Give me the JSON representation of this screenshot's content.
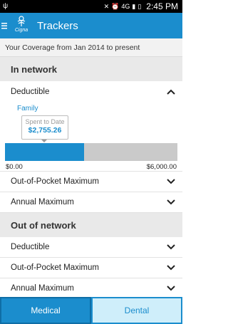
{
  "status_bar": {
    "time": "2:45 PM",
    "network": "4G",
    "icons": [
      "usb-icon",
      "mute-icon",
      "alarm-icon",
      "wifi-icon",
      "signal-icon",
      "battery-icon"
    ]
  },
  "app_bar": {
    "logo_text": "Cigna",
    "title": "Trackers"
  },
  "coverage": {
    "text": "Your Coverage from Jan 2014 to present"
  },
  "in_network": {
    "title": "In network",
    "deductible": {
      "label": "Deductible",
      "expanded": true,
      "coverage_type": "Family",
      "spent_label": "Spent to Date",
      "spent_value": "$2,755.26",
      "progress": 0.46,
      "min_label": "$0.00",
      "max_label": "$6,000.00"
    },
    "out_of_pocket_label": "Out-of-Pocket Maximum",
    "annual_max_label": "Annual Maximum"
  },
  "out_of_network": {
    "title": "Out of network",
    "deductible_label": "Deductible",
    "out_of_pocket_label": "Out-of-Pocket Maximum",
    "annual_max_label": "Annual Maximum"
  },
  "tabs": {
    "medical": "Medical",
    "dental": "Dental",
    "selected": "Medical"
  },
  "colors": {
    "brand_blue": "#1b8dcd",
    "tab_inactive": "#cfeefa"
  }
}
